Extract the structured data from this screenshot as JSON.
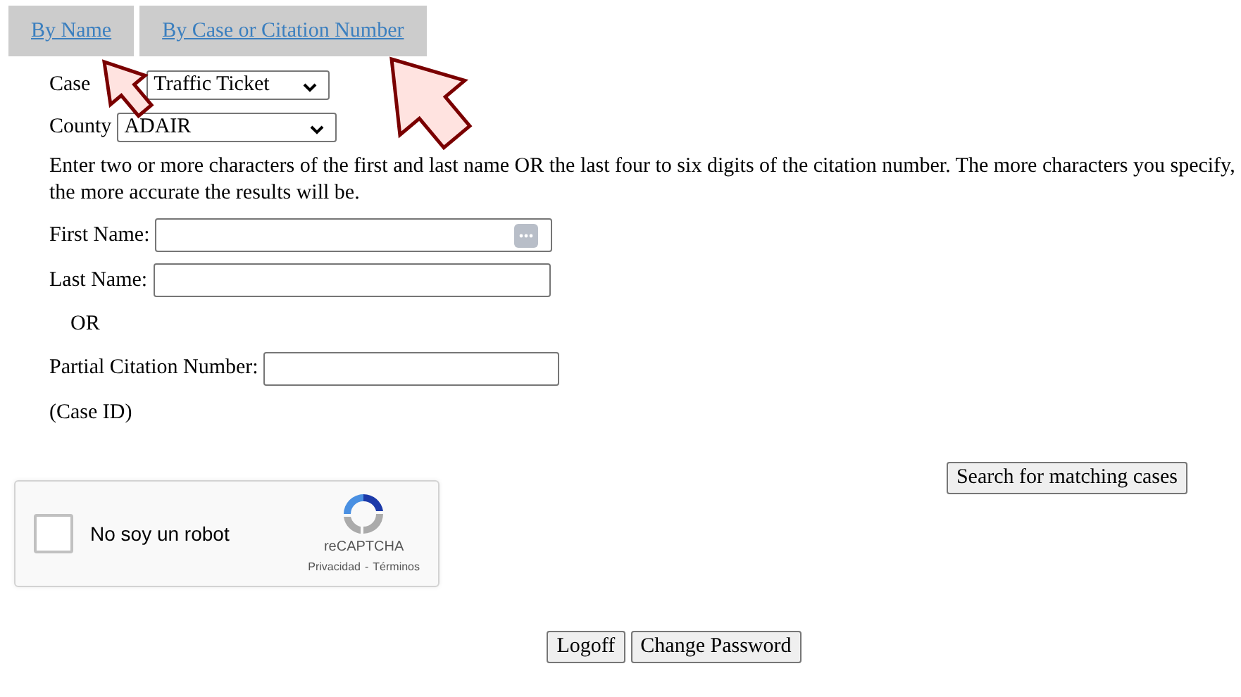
{
  "tabs": [
    {
      "label": "By Name"
    },
    {
      "label": "By Case or Citation Number"
    }
  ],
  "form": {
    "case_type": {
      "label": "Case",
      "value": "Traffic Ticket"
    },
    "county": {
      "label": "County",
      "value": "ADAIR"
    },
    "instructions": "Enter two or more characters of the first and last name OR the last four to six digits of the citation number. The more characters you specify, the more accurate the results will be.",
    "first_name": {
      "label": "First Name:"
    },
    "last_name": {
      "label": "Last Name:"
    },
    "or_text": "OR",
    "citation": {
      "label": "Partial Citation Number:"
    },
    "case_id_note": "(Case ID)",
    "search_button": "Search for matching cases"
  },
  "captcha": {
    "checked": false,
    "label": "No soy un robot",
    "brand": "reCAPTCHA",
    "privacy": "Privacidad",
    "separator": "-",
    "terms": "Términos"
  },
  "footer_buttons": [
    "Logoff",
    "Change Password"
  ],
  "annotations": [
    {
      "kind": "arrow"
    },
    {
      "kind": "arrow"
    }
  ]
}
